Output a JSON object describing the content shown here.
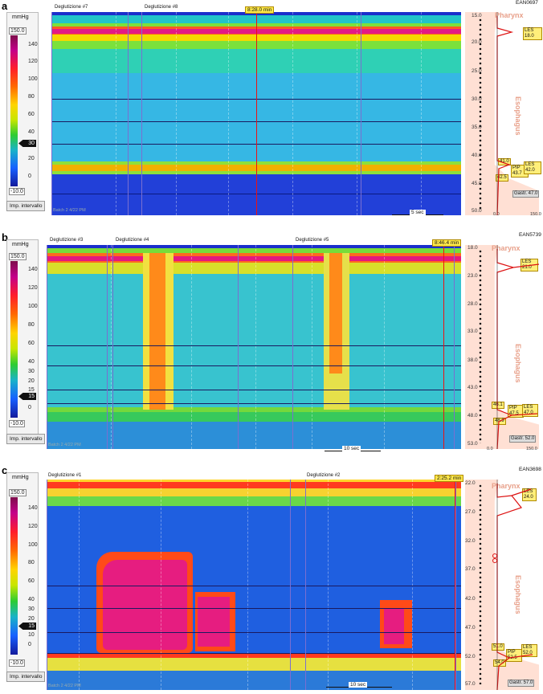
{
  "panels": [
    {
      "label": "a",
      "unit": "mmHg",
      "scale_max": "150.0",
      "scale_min": "-10.0",
      "ticks": [
        "140",
        "120",
        "100",
        "80",
        "60",
        "40",
        "20",
        "0"
      ],
      "pointer": "30",
      "button": "Imp. intervallo",
      "swallows": [
        "Deglutizione #7",
        "Deglutizione #8"
      ],
      "time": "8:28.0 min",
      "scale_bar": "5 sec",
      "id": "EAN0697",
      "depths": [
        "15.0",
        "20.0",
        "25.0",
        "30.0",
        "35.0",
        "40.0",
        "45.0",
        "50.0"
      ],
      "region_top": "Pharynx",
      "region_mid": "Esophagus",
      "tags": [
        "LES 18.0",
        "41.0",
        "PIP 43.7",
        "LES 42.0",
        "42.5",
        "Gastr. 47.0"
      ],
      "axis_min": "0.0",
      "axis_max": "150.0",
      "footer": "Batch 2 4/22 PM"
    },
    {
      "label": "b",
      "unit": "mmHg",
      "scale_max": "150.0",
      "scale_min": "-10.0",
      "ticks": [
        "140",
        "120",
        "100",
        "80",
        "60",
        "40",
        "30",
        "20",
        "15",
        "0"
      ],
      "pointer": "15",
      "button": "Imp. intervallo",
      "swallows": [
        "Deglutizione #3",
        "Deglutizione #4",
        "Deglutizione #5"
      ],
      "time": "8:46.4 min",
      "scale_bar": "10 sec",
      "id": "EAN5739",
      "depths": [
        "18.0",
        "23.0",
        "28.0",
        "33.0",
        "38.0",
        "43.0",
        "48.0",
        "53.0"
      ],
      "region_top": "Pharynx",
      "region_mid": "Esophagus",
      "tags": [
        "LES 21.0",
        "46.1",
        "PIP 47.5",
        "LES 47.0",
        "48.9",
        "Gastr. 52.0"
      ],
      "axis_min": "0.0",
      "axis_max": "150.0",
      "footer": "Batch 2 4/22 PM"
    },
    {
      "label": "c",
      "unit": "mmHg",
      "scale_max": "150.0",
      "scale_min": "-10.0",
      "ticks": [
        "140",
        "120",
        "100",
        "80",
        "60",
        "40",
        "30",
        "20",
        "15",
        "10",
        "0"
      ],
      "pointer": "15",
      "button": "Imp. intervallo",
      "swallows": [
        "Deglutizione #1",
        "Deglutizione #2"
      ],
      "time": "2:25.2 min",
      "scale_bar": "10 sec",
      "id": "EAN3698",
      "depths": [
        "22.0",
        "27.0",
        "32.0",
        "37.0",
        "42.0",
        "47.0",
        "52.0",
        "57.0"
      ],
      "region_top": "Pharynx",
      "region_mid": "Esophagus",
      "tags": [
        "LES 24.0",
        "51.0",
        "PIP 52.5",
        "LES 52.0",
        "54.0",
        "Gastr. 57.0"
      ],
      "axis_min": "0.0",
      "axis_max": "150.0",
      "footer": "Batch 2 4/22 PM"
    }
  ]
}
